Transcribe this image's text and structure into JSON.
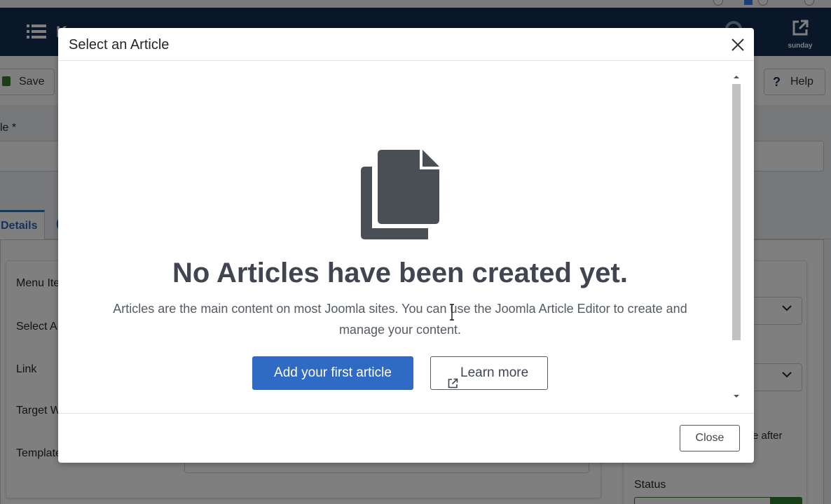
{
  "app": {
    "title": "K...",
    "site_link_label": "sunday"
  },
  "toolbar": {
    "save_label": "Save",
    "help_label": "Help"
  },
  "form": {
    "title_label": "le *",
    "tabs": [
      "Details",
      "("
    ],
    "fields": [
      "Menu Ite",
      "Select A",
      "Link",
      "Target W",
      "Template"
    ],
    "right_text": "e after",
    "status_label": "Status"
  },
  "modal": {
    "title": "Select an Article",
    "heading": "No Articles have been created yet.",
    "description": "Articles are the main content on most Joomla sites. You can use the Joomla Article Editor to create and manage your content.",
    "primary_button": "Add your first article",
    "secondary_button": "Learn more",
    "close_button": "Close"
  },
  "colors": {
    "topbar": "#132f53",
    "primary": "#2f6ac4",
    "status_green": "#2f7d32",
    "icon_gray": "#4a4e55"
  },
  "icons": {
    "empty_state": "copy-documents-icon",
    "learn_more": "external-link-icon",
    "close": "close-icon"
  }
}
